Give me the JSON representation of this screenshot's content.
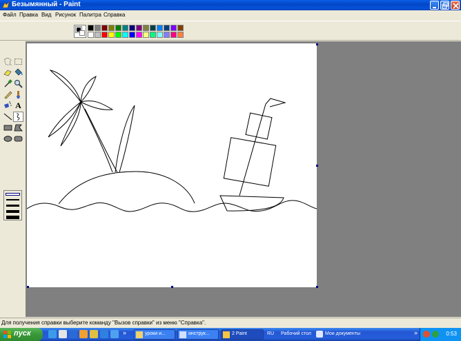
{
  "window": {
    "title": "Безымянный - Paint"
  },
  "menu": [
    "Файл",
    "Правка",
    "Вид",
    "Рисунок",
    "Палитра",
    "Справка"
  ],
  "palette": {
    "top_row": [
      "#000000",
      "#808080",
      "#800000",
      "#808000",
      "#008000",
      "#008080",
      "#000080",
      "#800080",
      "#808040",
      "#004040",
      "#0080ff",
      "#004080",
      "#8000ff",
      "#804000"
    ],
    "bottom_row": [
      "#ffffff",
      "#c0c0c0",
      "#ff0000",
      "#ffff00",
      "#00ff00",
      "#00ffff",
      "#0000ff",
      "#ff00ff",
      "#ffff80",
      "#00ff80",
      "#80ffff",
      "#8080ff",
      "#ff0080",
      "#ff8040"
    ]
  },
  "tools": {
    "text_tool_label": "A"
  },
  "statusbar": {
    "text": "Для получения справки выберите команду \"Вызов справки\" из меню \"Справка\"."
  },
  "taskbar": {
    "start": "пуск",
    "more": "»",
    "tasks": [
      "уроки и...",
      "инструк...",
      "2 Paint"
    ],
    "lang": "RU",
    "desktop_label": "Рабочий стол",
    "docs_label": "Мои документы",
    "tray_more": "»",
    "clock": "0:53"
  }
}
